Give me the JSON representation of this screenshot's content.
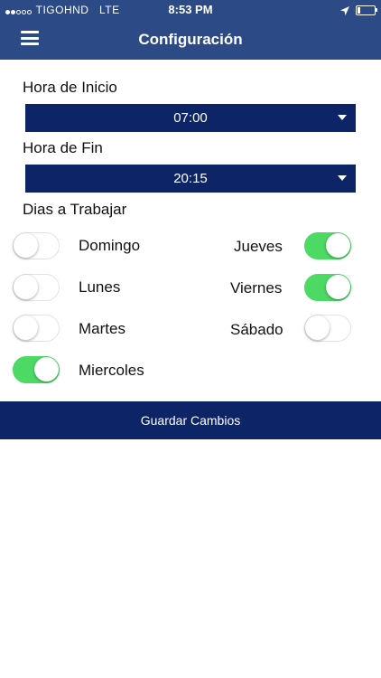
{
  "status_bar": {
    "carrier": "TIGOHND",
    "network": "LTE",
    "time": "8:53 PM",
    "signal_bars_filled": 2,
    "signal_bars_total": 5,
    "location_icon": "location-arrow-icon",
    "battery_icon": "battery-icon"
  },
  "header": {
    "menu_icon": "hamburger-menu-icon",
    "title": "Configuración"
  },
  "form": {
    "start_label": "Hora de Inicio",
    "start_value": "07:00",
    "end_label": "Hora de Fin",
    "end_value": "20:15",
    "days_label": "Dias a Trabajar"
  },
  "days": {
    "domingo": {
      "label": "Domingo",
      "on": false
    },
    "lunes": {
      "label": "Lunes",
      "on": false
    },
    "martes": {
      "label": "Martes",
      "on": false
    },
    "miercoles": {
      "label": "Miercoles",
      "on": true
    },
    "jueves": {
      "label": "Jueves",
      "on": true
    },
    "viernes": {
      "label": "Viernes",
      "on": true
    },
    "sabado": {
      "label": "Sábado",
      "on": false
    }
  },
  "actions": {
    "save_label": "Guardar Cambios"
  },
  "colors": {
    "header": "#2b4a86",
    "primary": "#0d2566",
    "toggle_on": "#4cd964"
  }
}
